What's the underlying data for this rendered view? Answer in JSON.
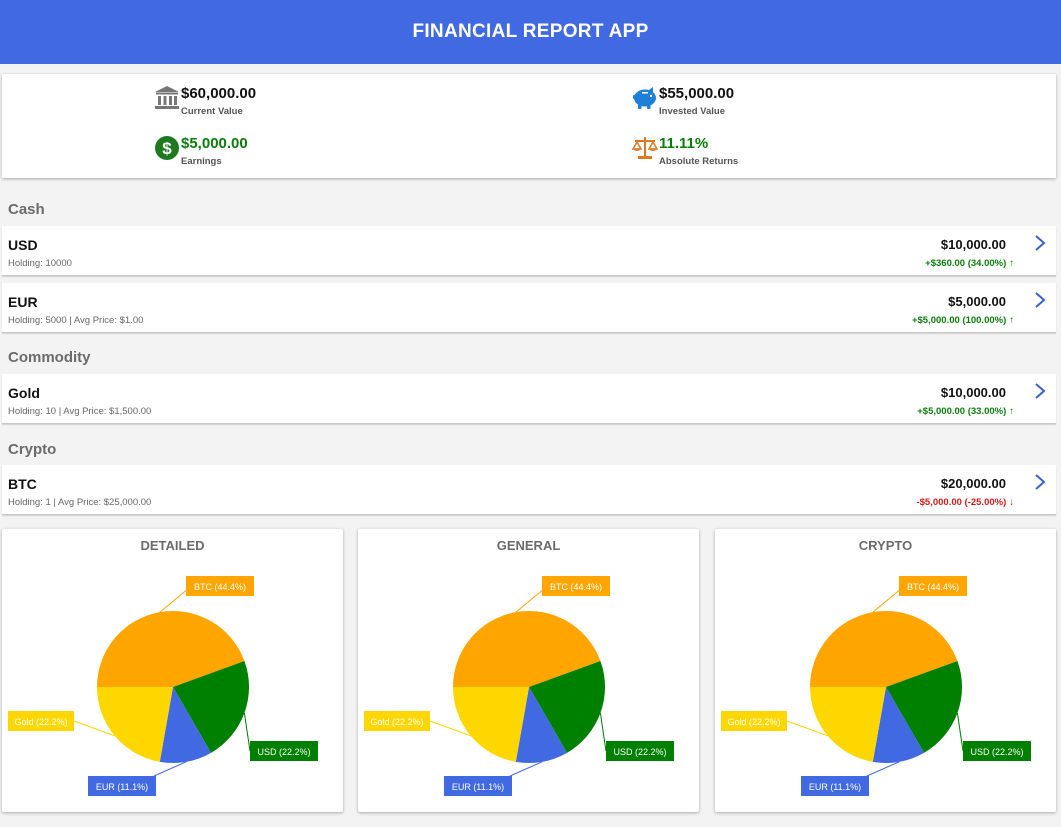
{
  "app": {
    "title": "FINANCIAL REPORT APP"
  },
  "summary": {
    "current_value": {
      "value": "$60,000.00",
      "label": "Current Value",
      "icon": "bank-icon"
    },
    "invested_value": {
      "value": "$55,000.00",
      "label": "Invested Value",
      "icon": "piggy-bank-icon"
    },
    "earnings": {
      "value": "$5,000.00",
      "label": "Earnings",
      "icon": "dollar-icon"
    },
    "absolute_returns": {
      "value": "11.11%",
      "label": "Absolute Returns",
      "icon": "scale-icon"
    }
  },
  "sections": [
    {
      "title": "Cash",
      "items": [
        {
          "name": "USD",
          "sub": "Holding: 10000",
          "value": "$10,000.00",
          "change": "+$360.00 (34.00%)",
          "arrow": "↑",
          "direction": "up"
        },
        {
          "name": "EUR",
          "sub": "Holding: 5000 | Avg Price: $1.00",
          "value": "$5,000.00",
          "change": "+$5,000.00 (100.00%)",
          "arrow": "↑",
          "direction": "up"
        }
      ]
    },
    {
      "title": "Commodity",
      "items": [
        {
          "name": "Gold",
          "sub": "Holding: 10 | Avg Price: $1,500.00",
          "value": "$10,000.00",
          "change": "+$5,000.00 (33.00%)",
          "arrow": "↑",
          "direction": "up"
        }
      ]
    },
    {
      "title": "Crypto",
      "items": [
        {
          "name": "BTC",
          "sub": "Holding: 1 | Avg Price: $25,000.00",
          "value": "$20,000.00",
          "change": "-$5,000.00 (-25.00%)",
          "arrow": "↓",
          "direction": "down"
        }
      ]
    }
  ],
  "colors": {
    "header": "#4169e1",
    "btc": "#ffa500",
    "usd": "#008000",
    "eur": "#4169e1",
    "gold": "#ffd700",
    "positive": "#0a7d0a",
    "negative": "#d01a1a"
  },
  "chart_data": [
    {
      "type": "pie",
      "title": "DETAILED",
      "labels": [
        "BTC (44.4%)",
        "USD (22.2%)",
        "EUR (11.1%)",
        "Gold (22.2%)"
      ],
      "values": [
        44.4,
        22.2,
        11.1,
        22.2
      ],
      "colors": [
        "#ffa500",
        "#008000",
        "#4169e1",
        "#ffd700"
      ]
    },
    {
      "type": "pie",
      "title": "GENERAL",
      "labels": [
        "BTC (44.4%)",
        "USD (22.2%)",
        "EUR (11.1%)",
        "Gold (22.2%)"
      ],
      "values": [
        44.4,
        22.2,
        11.1,
        22.2
      ],
      "colors": [
        "#ffa500",
        "#008000",
        "#4169e1",
        "#ffd700"
      ]
    },
    {
      "type": "pie",
      "title": "CRYPTO",
      "labels": [
        "BTC (44.4%)",
        "USD (22.2%)",
        "EUR (11.1%)",
        "Gold (22.2%)"
      ],
      "values": [
        44.4,
        22.2,
        11.1,
        22.2
      ],
      "colors": [
        "#ffa500",
        "#008000",
        "#4169e1",
        "#ffd700"
      ]
    }
  ]
}
